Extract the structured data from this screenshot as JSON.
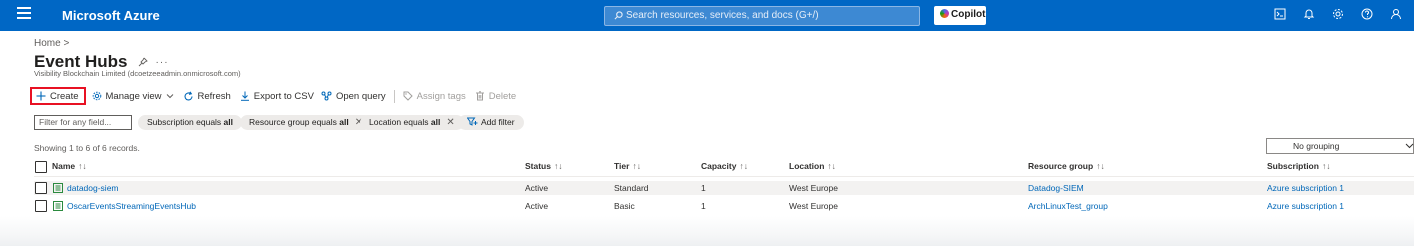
{
  "topbar": {
    "brand": "Microsoft Azure",
    "search_placeholder": "Search resources, services, and docs (G+/)",
    "copilot_label": "Copilot",
    "icons": [
      "cloud-shell-icon",
      "bell-icon",
      "gear-icon",
      "help-icon",
      "feedback-icon"
    ]
  },
  "breadcrumb": {
    "home": "Home",
    "separator": ">"
  },
  "page": {
    "title": "Event Hubs",
    "subtitle": "Visibility Blockchain Limited (dcoetzeeadmin.onmicrosoft.com)"
  },
  "toolbar": {
    "create": "Create",
    "manage_view": "Manage view",
    "refresh": "Refresh",
    "export": "Export to CSV",
    "open_query": "Open query",
    "assign_tags": "Assign tags",
    "delete": "Delete"
  },
  "filters": {
    "placeholder": "Filter for any field...",
    "subscription_prefix": "Subscription equals ",
    "subscription_value": "all",
    "resource_group_prefix": "Resource group equals ",
    "resource_group_value": "all",
    "location_prefix": "Location equals ",
    "location_value": "all",
    "add_filter": "Add filter"
  },
  "records_text": "Showing 1 to 6 of 6 records.",
  "grouping": "No grouping",
  "table": {
    "columns": {
      "name": "Name",
      "status": "Status",
      "tier": "Tier",
      "capacity": "Capacity",
      "location": "Location",
      "resource_group": "Resource group",
      "subscription": "Subscription"
    },
    "sort_glyph": "↑↓",
    "name_sort_glyph": "↑↓",
    "rows": [
      {
        "name": "datadog-siem",
        "status": "Active",
        "tier": "Standard",
        "capacity": "1",
        "location": "West Europe",
        "resource_group": "Datadog-SIEM",
        "subscription": "Azure subscription 1"
      },
      {
        "name": "OscarEventsStreamingEventsHub",
        "status": "Active",
        "tier": "Basic",
        "capacity": "1",
        "location": "West Europe",
        "resource_group": "ArchLinuxTest_group",
        "subscription": "Azure subscription 1"
      }
    ]
  },
  "colors": {
    "topbar": "#0067c5",
    "link": "#0067b8",
    "highlight_border": "#e81123"
  }
}
